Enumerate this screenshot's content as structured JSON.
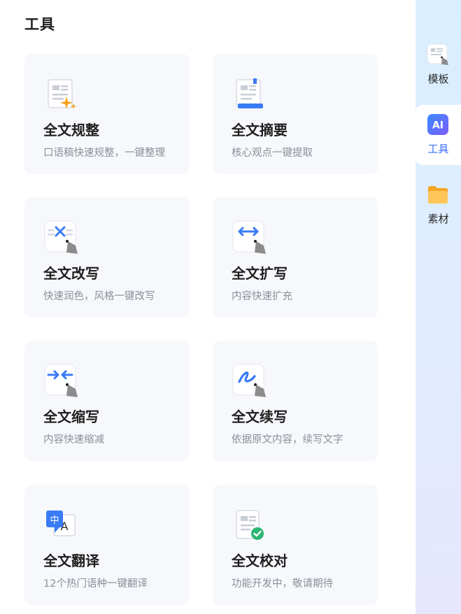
{
  "page": {
    "title": "工具"
  },
  "tools": [
    {
      "title": "全文规整",
      "desc": "口语稿快速规整，一键整理",
      "icon": "document-sparkle-icon"
    },
    {
      "title": "全文摘要",
      "desc": "核心观点一键提取",
      "icon": "document-summary-icon"
    },
    {
      "title": "全文改写",
      "desc": "快速润色，风格一键改写",
      "icon": "rewrite-icon"
    },
    {
      "title": "全文扩写",
      "desc": "内容快速扩充",
      "icon": "expand-icon"
    },
    {
      "title": "全文缩写",
      "desc": "内容快速缩减",
      "icon": "shrink-icon"
    },
    {
      "title": "全文续写",
      "desc": "依据原文内容，续写文字",
      "icon": "continue-writing-icon"
    },
    {
      "title": "全文翻译",
      "desc": "12个热门语种一键翻译",
      "icon": "translate-icon"
    },
    {
      "title": "全文校对",
      "desc": "功能开发中，敬请期待",
      "icon": "proofread-icon"
    }
  ],
  "sidebar": {
    "items": [
      {
        "label": "模板",
        "icon": "template-icon",
        "active": false
      },
      {
        "label": "工具",
        "icon": "ai-icon",
        "active": true,
        "icon_text": "AI"
      },
      {
        "label": "素材",
        "icon": "folder-icon",
        "active": false
      }
    ]
  },
  "colors": {
    "accent": "#3a6cf6",
    "card_bg": "#f7f8fc",
    "desc": "#8a8f99"
  }
}
